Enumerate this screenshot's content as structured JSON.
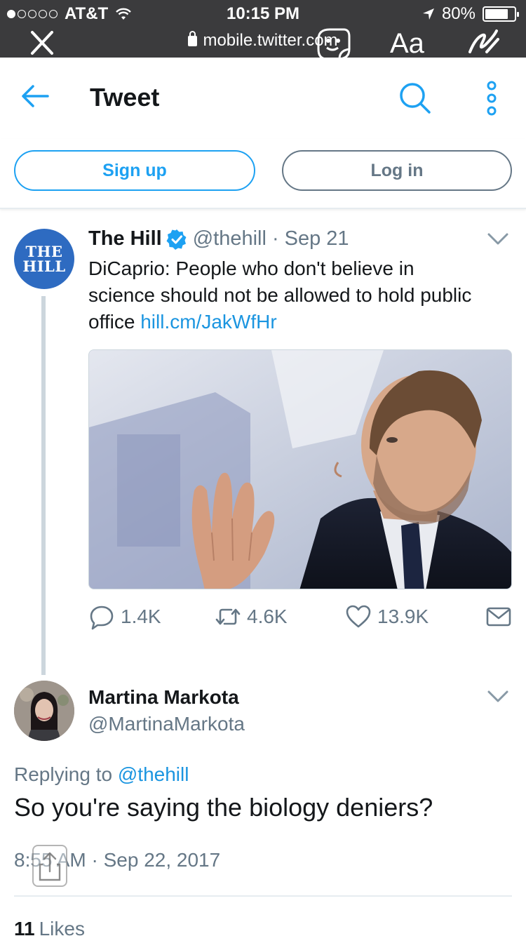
{
  "status_bar": {
    "carrier": "AT&T",
    "time": "10:15 PM",
    "battery": "80%",
    "battery_level": 0.8,
    "signal_bars_filled": 1
  },
  "browser": {
    "url": "mobile.twitter.com",
    "text_tool_label": "Aa"
  },
  "header": {
    "title": "Tweet"
  },
  "auth": {
    "signup_label": "Sign up",
    "login_label": "Log in"
  },
  "tweet": {
    "avatar_text_line1": "THE",
    "avatar_text_line2": "HILL",
    "author_name": "The Hill",
    "handle": "@thehill",
    "separator": "·",
    "date": "Sep 21",
    "text": "DiCaprio: People who don't believe in science should not be allowed to hold public office ",
    "link": "hill.cm/JakWfHr",
    "replies": "1.4K",
    "retweets": "4.6K",
    "likes": "13.9K"
  },
  "reply": {
    "author_name": "Martina Markota",
    "handle": "@MartinaMarkota",
    "replying_prefix": "Replying to ",
    "replying_to": "@thehill",
    "text": "So you're saying the biology deniers?",
    "timestamp": "8:55 AM · Sep 22, 2017",
    "likes_count": "11",
    "likes_label": "Likes"
  },
  "colors": {
    "twitter_blue": "#1da1f2",
    "link_blue": "#1b95e0",
    "gray_text": "#657786",
    "status_bar_bg": "#3b3b3d",
    "hill_blue": "#2e6bc1"
  }
}
